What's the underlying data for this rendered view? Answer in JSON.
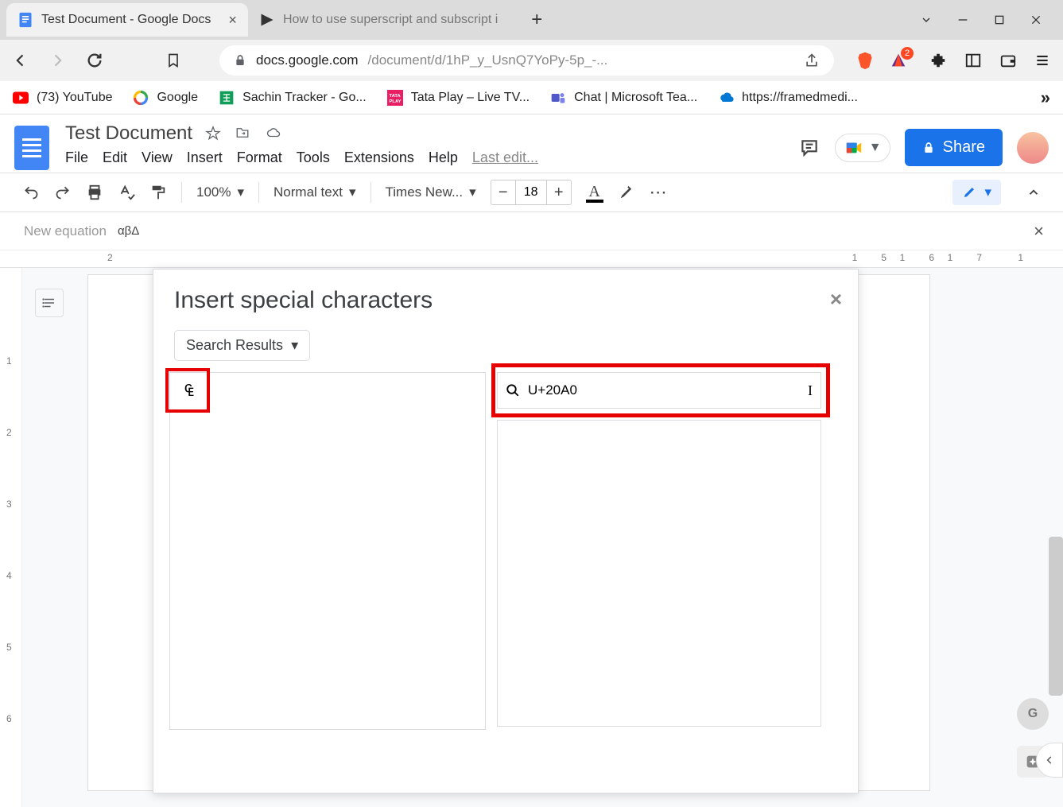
{
  "browser": {
    "tabs": [
      {
        "title": "Test Document - Google Docs",
        "active": true
      },
      {
        "title": "How to use superscript and subscript i",
        "active": false
      }
    ],
    "url_host": "docs.google.com",
    "url_path": "/document/d/1hP_y_UsnQ7YoPy-5p_-...",
    "badge_count": "2"
  },
  "bookmarks": [
    {
      "label": "(73) YouTube"
    },
    {
      "label": "Google"
    },
    {
      "label": "Sachin Tracker - Go..."
    },
    {
      "label": "Tata Play – Live TV..."
    },
    {
      "label": "Chat | Microsoft Tea..."
    },
    {
      "label": "https://framedmedi..."
    }
  ],
  "docs": {
    "title": "Test Document",
    "menus": [
      "File",
      "Edit",
      "View",
      "Insert",
      "Format",
      "Tools",
      "Extensions",
      "Help"
    ],
    "last_edit": "Last edit...",
    "share_label": "Share",
    "toolbar": {
      "zoom": "100%",
      "paragraph_style": "Normal text",
      "font": "Times New...",
      "font_size": "18"
    },
    "equation_bar_label": "New equation",
    "equation_symbols": "αβΔ"
  },
  "ruler_right": [
    "15",
    "16",
    "17"
  ],
  "left_ruler": [
    "1",
    "2",
    "3",
    "4",
    "5",
    "6"
  ],
  "dialog": {
    "title": "Insert special characters",
    "dropdown_label": "Search Results",
    "search_value": "U+20A0",
    "result_char": "₠"
  }
}
